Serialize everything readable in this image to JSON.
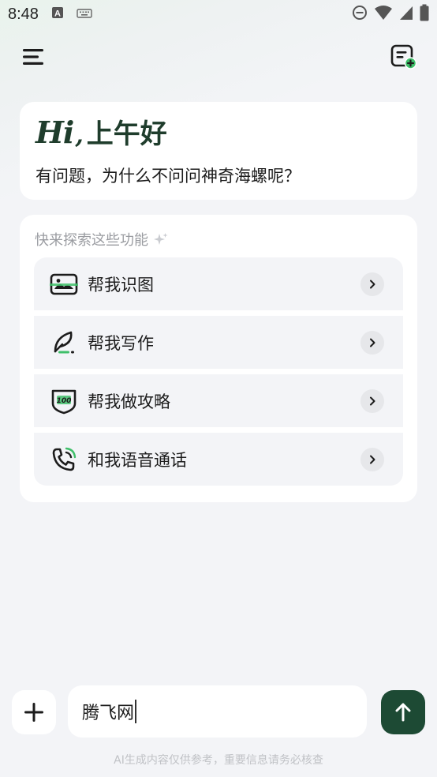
{
  "status_bar": {
    "time": "8:48",
    "left_icons": [
      "text-a-icon",
      "keyboard-icon"
    ],
    "right_icons": [
      "dnd-icon",
      "wifi-icon",
      "signal-icon",
      "battery-icon"
    ]
  },
  "top_bar": {
    "menu_icon": "hamburger-menu-icon",
    "new_chat_icon": "new-chat-icon"
  },
  "greeting": {
    "hi": "Hi",
    "comma": ",",
    "text": "上午好",
    "subtitle": "有问题，为什么不问问神奇海螺呢？"
  },
  "features": {
    "title": "快来探索这些功能",
    "items": [
      {
        "label": "帮我识图",
        "icon": "image-recognition-icon"
      },
      {
        "label": "帮我写作",
        "icon": "writing-feather-icon"
      },
      {
        "label": "帮我做攻略",
        "icon": "guide-shield-icon"
      },
      {
        "label": "和我语音通话",
        "icon": "phone-call-icon"
      }
    ]
  },
  "composer": {
    "input_value": "腾飞网",
    "plus_icon": "plus-icon",
    "send_icon": "send-arrow-icon"
  },
  "disclaimer": "AI生成内容仅供参考，重要信息请务必核查",
  "colors": {
    "brand_dark_green": "#1d4a34",
    "accent_green": "#3fbf6a",
    "card_bg": "#ffffff",
    "item_bg": "#f3f4f7"
  }
}
